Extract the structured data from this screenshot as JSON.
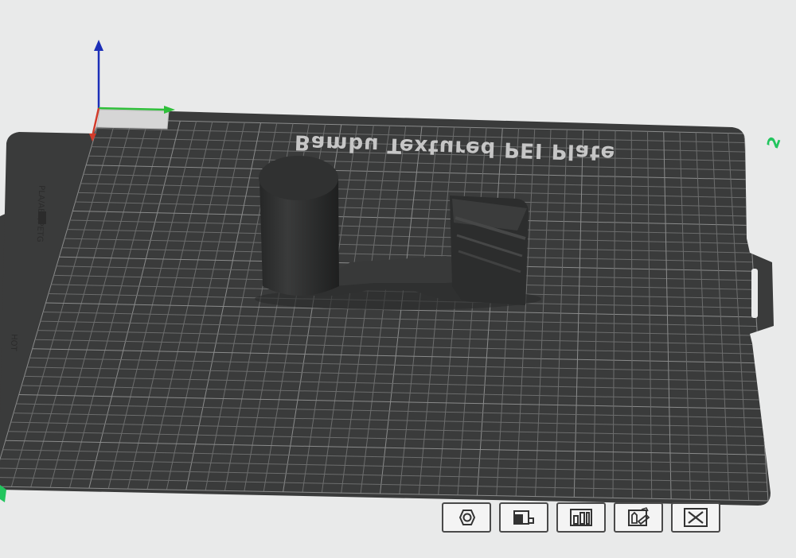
{
  "plate": {
    "name": "Bambu Textured PEI Plate",
    "number": "2",
    "tab_label_top": "PLA/ABS/PETG",
    "tab_label_bottom": "HOT",
    "colors": {
      "background": "#e9eaea",
      "plate_surface": "#3a3b3b",
      "grid_line": "#6c6d6d",
      "model": "#2e2f2f",
      "x_axis": "#d23b2b",
      "y_axis": "#2fbf3a",
      "z_axis": "#1c2fb8",
      "plate_number": "#22c55e"
    }
  },
  "toolbar": {
    "buttons": [
      {
        "name": "orient-button",
        "icon": "hexagon-nut-icon"
      },
      {
        "name": "arrange-button",
        "icon": "lay-flat-icon"
      },
      {
        "name": "layout-button",
        "icon": "arrange-bars-icon"
      },
      {
        "name": "edit-button",
        "icon": "edit-plate-icon"
      },
      {
        "name": "close-button",
        "icon": "close-icon"
      }
    ]
  }
}
